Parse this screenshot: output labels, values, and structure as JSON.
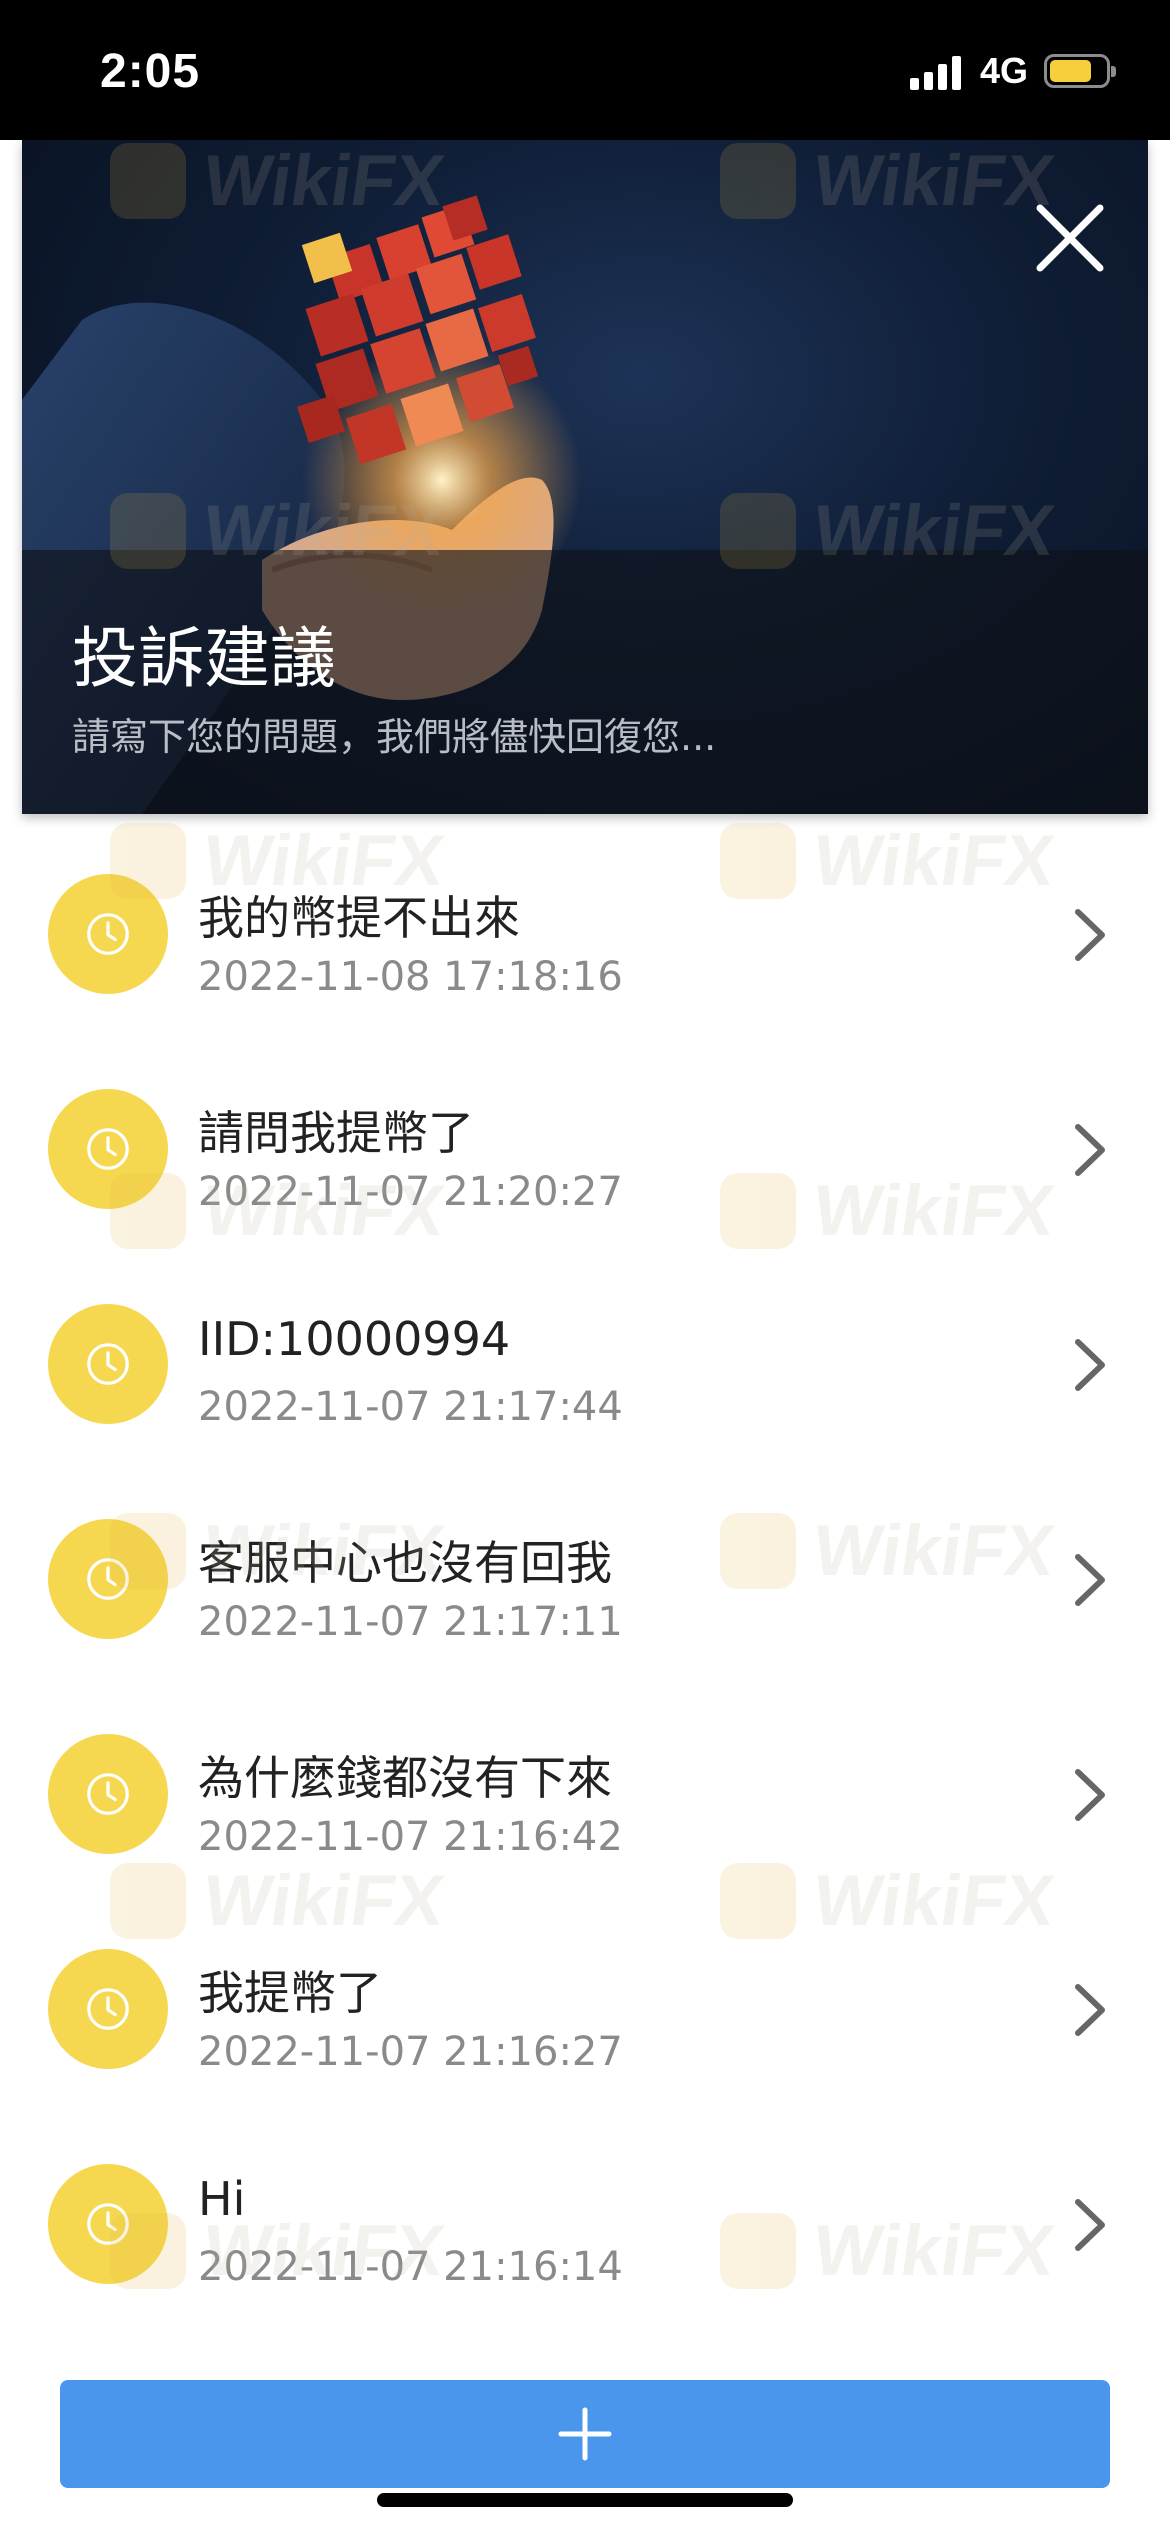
{
  "status_bar": {
    "time": "2:05",
    "network": "4G",
    "battery_level": 0.75
  },
  "hero": {
    "title": "投訴建議",
    "subtitle": "請寫下您的問題，我們將儘快回復您..."
  },
  "watermark_text": "WikiFX",
  "tickets": [
    {
      "title": "我的幣提不出來",
      "time": "2022-11-08 17:18:16"
    },
    {
      "title": "請問我提幣了",
      "time": "2022-11-07 21:20:27"
    },
    {
      "title": "IID:10000994",
      "time": "2022-11-07 21:17:44"
    },
    {
      "title": "客服中心也沒有回我",
      "time": "2022-11-07 21:17:11"
    },
    {
      "title": "為什麼錢都沒有下來",
      "time": "2022-11-07 21:16:42"
    },
    {
      "title": "我提幣了",
      "time": "2022-11-07 21:16:27"
    },
    {
      "title": "Hi",
      "time": "2022-11-07 21:16:14"
    }
  ],
  "colors": {
    "status_bar": "#000000",
    "badge": "#f6d850",
    "add_button": "#4a96ec",
    "title_text": "#222222",
    "time_text": "#8a8a8a"
  },
  "icons": {
    "close": "close-icon",
    "badge": "clock-icon",
    "row_action": "chevron-right-icon",
    "add": "plus-icon"
  }
}
